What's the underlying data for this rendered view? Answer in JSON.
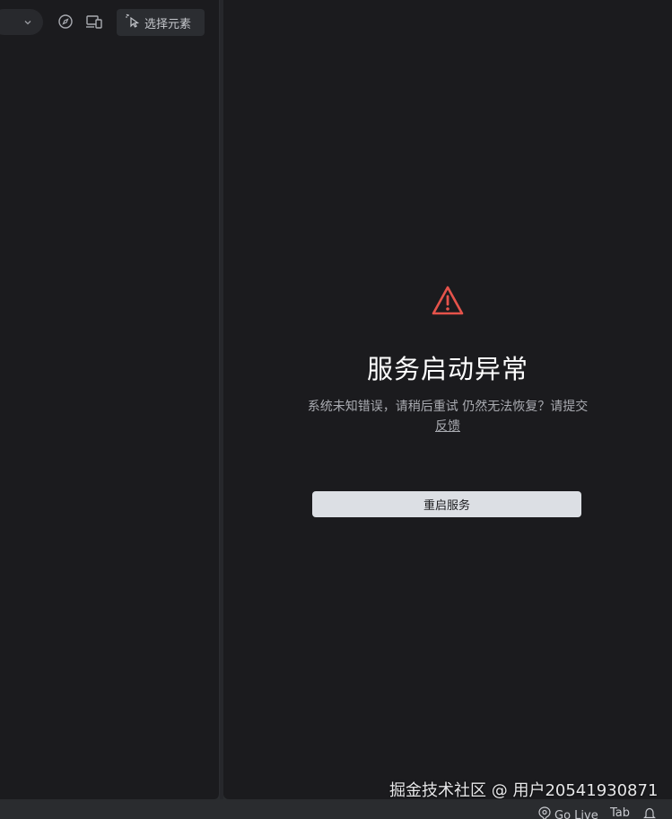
{
  "toolbar": {
    "dropdown_icon": "chevron-down-icon",
    "compass_icon": "compass-icon",
    "devices_icon": "devices-icon",
    "select_element_label": "选择元素"
  },
  "error": {
    "icon": "warning-icon",
    "title": "服务启动异常",
    "description": "系统未知错误，请稍后重试 仍然无法恢复？请提交",
    "feedback_link": "反馈",
    "restart_label": "重启服务"
  },
  "watermark": "掘金技术社区 @ 用户20541930871",
  "status_bar": {
    "go_live": "Go Live",
    "tab": "Tab"
  },
  "colors": {
    "background": "#1b1b1e",
    "warning": "#e5534b",
    "button": "#dcdfe4"
  }
}
